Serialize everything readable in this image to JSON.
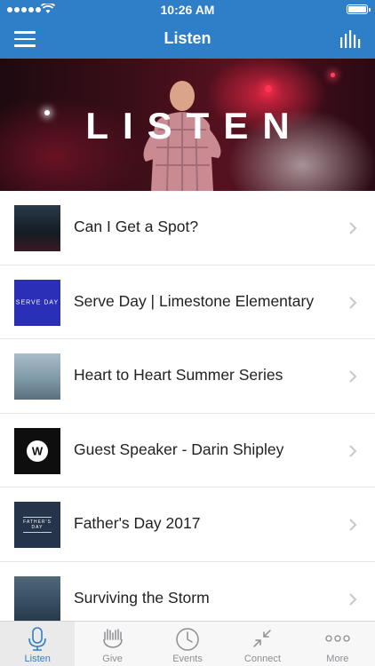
{
  "status_bar": {
    "time": "10:26 AM"
  },
  "nav": {
    "title": "Listen"
  },
  "hero": {
    "title": "LISTEN"
  },
  "list": {
    "items": [
      {
        "label": "Can I Get a Spot?",
        "thumb_color": "#1b2630",
        "thumb_text": ""
      },
      {
        "label": "Serve Day | Limestone Elementary",
        "thumb_color": "#2b2fb8",
        "thumb_text": "SERVE DAY"
      },
      {
        "label": "Heart to Heart Summer Series",
        "thumb_color": "#7f9aa8",
        "thumb_text": ""
      },
      {
        "label": "Guest Speaker - Darin Shipley",
        "thumb_color": "#0e0e0e",
        "thumb_text": "W"
      },
      {
        "label": "Father's Day 2017",
        "thumb_color": "#25344a",
        "thumb_text": "FATHER'S DAY"
      },
      {
        "label": "Surviving the Storm",
        "thumb_color": "#3a5064",
        "thumb_text": ""
      }
    ]
  },
  "tabs": [
    {
      "label": "Listen",
      "icon": "microphone-icon",
      "active": true
    },
    {
      "label": "Give",
      "icon": "hands-icon",
      "active": false
    },
    {
      "label": "Events",
      "icon": "clock-icon",
      "active": false
    },
    {
      "label": "Connect",
      "icon": "arrows-in-icon",
      "active": false
    },
    {
      "label": "More",
      "icon": "more-dots-icon",
      "active": false
    }
  ],
  "colors": {
    "accent": "#2f7ec8",
    "tab_inactive": "#8e8e93"
  }
}
